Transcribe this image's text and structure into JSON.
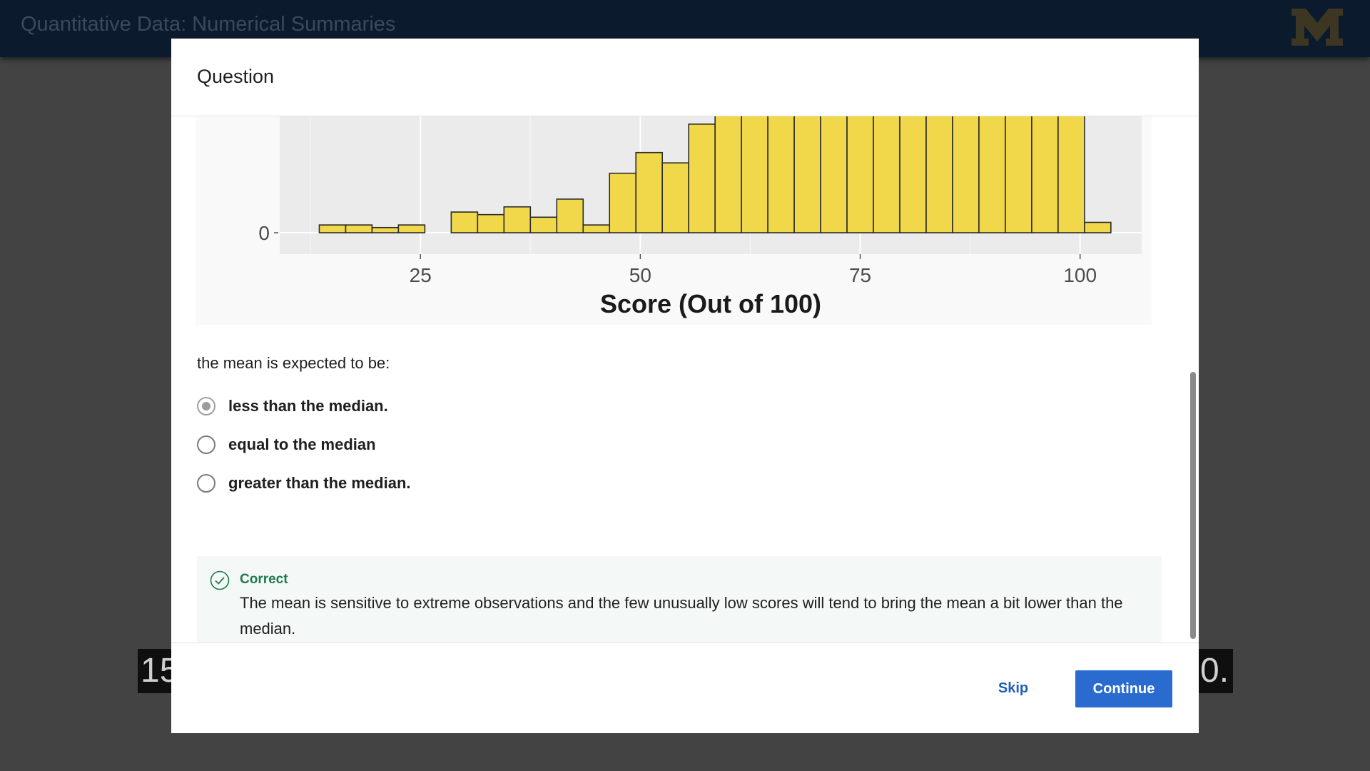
{
  "background": {
    "course_title": "Quantitative Data: Numerical Summaries",
    "caption_left": "15",
    "caption_right": "0."
  },
  "modal": {
    "title": "Question",
    "chart_data": {
      "type": "bar",
      "subtype": "histogram",
      "xlabel": "Score (Out of 100)",
      "x_ticks": [
        "25",
        "50",
        "75",
        "100"
      ],
      "y_ticks_visible": [
        "0"
      ],
      "xlim": [
        9,
        107
      ],
      "ylim_visible": [
        -0.8,
        4.5
      ],
      "bin_width": 3,
      "bins": [
        {
          "x_start": 13.5,
          "value": 0.3
        },
        {
          "x_start": 16.5,
          "value": 0.3
        },
        {
          "x_start": 19.5,
          "value": 0.2
        },
        {
          "x_start": 22.5,
          "value": 0.3
        },
        {
          "x_start": 25.5,
          "value": 0.0
        },
        {
          "x_start": 28.5,
          "value": 0.8
        },
        {
          "x_start": 31.5,
          "value": 0.7
        },
        {
          "x_start": 34.5,
          "value": 1.0
        },
        {
          "x_start": 37.5,
          "value": 0.6
        },
        {
          "x_start": 40.5,
          "value": 1.3
        },
        {
          "x_start": 43.5,
          "value": 0.3
        },
        {
          "x_start": 46.5,
          "value": 2.3
        },
        {
          "x_start": 49.5,
          "value": 3.1
        },
        {
          "x_start": 52.5,
          "value": 2.7
        },
        {
          "x_start": 55.5,
          "value": 4.2
        },
        {
          "x_start": 58.5,
          "value": 5
        },
        {
          "x_start": 61.5,
          "value": 5
        },
        {
          "x_start": 64.5,
          "value": 5
        },
        {
          "x_start": 67.5,
          "value": 5
        },
        {
          "x_start": 70.5,
          "value": 5
        },
        {
          "x_start": 73.5,
          "value": 5
        },
        {
          "x_start": 76.5,
          "value": 5
        },
        {
          "x_start": 79.5,
          "value": 5
        },
        {
          "x_start": 82.5,
          "value": 5
        },
        {
          "x_start": 85.5,
          "value": 5
        },
        {
          "x_start": 88.5,
          "value": 5
        },
        {
          "x_start": 91.5,
          "value": 5
        },
        {
          "x_start": 94.5,
          "value": 5
        },
        {
          "x_start": 97.5,
          "value": 5
        },
        {
          "x_start": 100.5,
          "value": 0.4
        }
      ],
      "bar_color": "#f1d84b",
      "panel_color": "#ebebeb",
      "grid": true
    },
    "question_stem": "the mean is expected to be:",
    "options": [
      {
        "label": "less than the median.",
        "selected": true
      },
      {
        "label": "equal to the median",
        "selected": false
      },
      {
        "label": "greater than the median.",
        "selected": false
      }
    ],
    "feedback": {
      "title": "Correct",
      "text": "The mean is sensitive to extreme observations and the few unusually low scores will tend to bring the mean a bit lower than the median."
    },
    "footer": {
      "skip_label": "Skip",
      "continue_label": "Continue"
    }
  },
  "colors": {
    "accent": "#2a6bd0",
    "correct": "#1f7a4d",
    "michigan_maize": "#c8a43a"
  }
}
